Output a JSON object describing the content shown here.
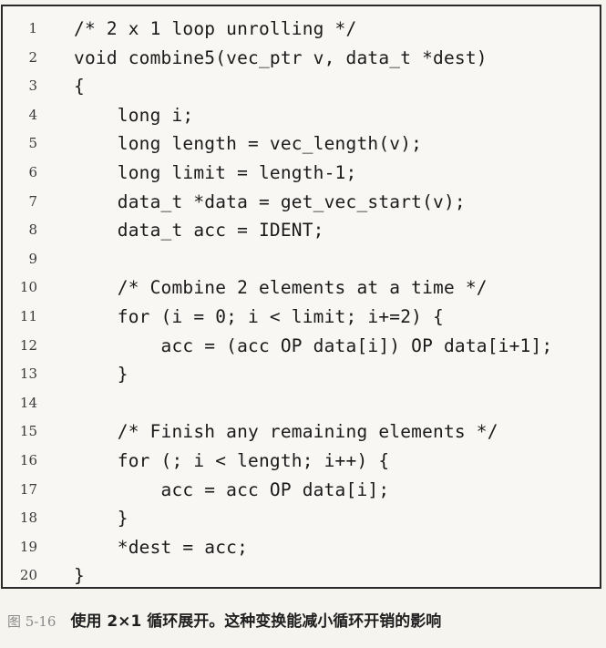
{
  "code": {
    "lines": [
      {
        "num": "1",
        "text": "/* 2 x 1 loop unrolling */"
      },
      {
        "num": "2",
        "text": "void combine5(vec_ptr v, data_t *dest)"
      },
      {
        "num": "3",
        "text": "{"
      },
      {
        "num": "4",
        "text": "    long i;"
      },
      {
        "num": "5",
        "text": "    long length = vec_length(v);"
      },
      {
        "num": "6",
        "text": "    long limit = length-1;"
      },
      {
        "num": "7",
        "text": "    data_t *data = get_vec_start(v);"
      },
      {
        "num": "8",
        "text": "    data_t acc = IDENT;"
      },
      {
        "num": "9",
        "text": ""
      },
      {
        "num": "10",
        "text": "    /* Combine 2 elements at a time */"
      },
      {
        "num": "11",
        "text": "    for (i = 0; i < limit; i+=2) {"
      },
      {
        "num": "12",
        "text": "        acc = (acc OP data[i]) OP data[i+1];"
      },
      {
        "num": "13",
        "text": "    }"
      },
      {
        "num": "14",
        "text": ""
      },
      {
        "num": "15",
        "text": "    /* Finish any remaining elements */"
      },
      {
        "num": "16",
        "text": "    for (; i < length; i++) {"
      },
      {
        "num": "17",
        "text": "        acc = acc OP data[i];"
      },
      {
        "num": "18",
        "text": "    }"
      },
      {
        "num": "19",
        "text": "    *dest = acc;"
      },
      {
        "num": "20",
        "text": "}"
      }
    ]
  },
  "caption": {
    "label": "图 5-16",
    "text": "使用 2×1 循环展开。这种变换能减小循环开销的影响"
  }
}
